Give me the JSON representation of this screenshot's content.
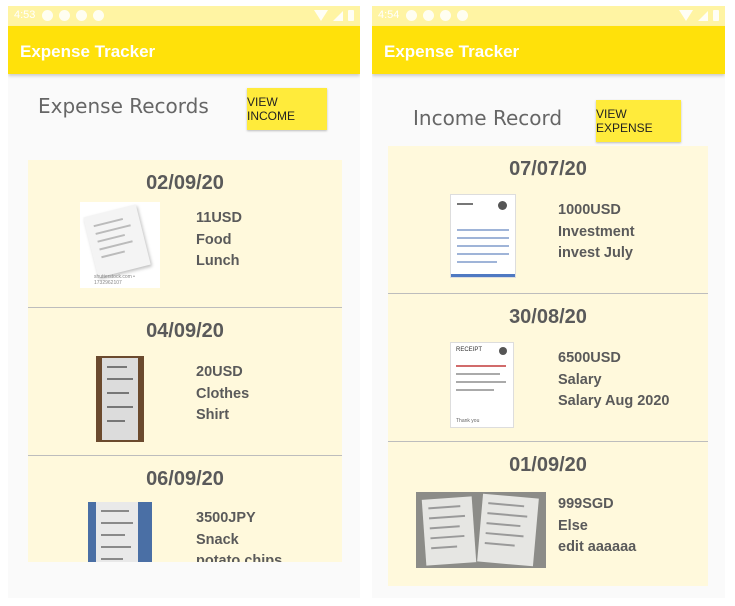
{
  "left": {
    "status_bar": {
      "time": "4:53"
    },
    "app_title": "Expense Tracker",
    "header_title": "Expense Records",
    "toggle_button": "VIEW INCOME",
    "records": [
      {
        "date": "02/09/20",
        "amount": "11USD",
        "category": "Food",
        "note": "Lunch",
        "thumb_caption": "shutterstock.com • 1732962107"
      },
      {
        "date": "04/09/20",
        "amount": "20USD",
        "category": "Clothes",
        "note": "Shirt"
      },
      {
        "date": "06/09/20",
        "amount": "3500JPY",
        "category": "Snack",
        "note": "potato chips"
      }
    ]
  },
  "right": {
    "status_bar": {
      "time": "4:54"
    },
    "app_title": "Expense Tracker",
    "header_title": "Income Record",
    "toggle_button": "VIEW EXPENSE",
    "records": [
      {
        "date": "07/07/20",
        "amount": "1000USD",
        "category": "Investment",
        "note": "invest July"
      },
      {
        "date": "30/08/20",
        "amount": "6500USD",
        "category": "Salary",
        "note": "Salary Aug 2020",
        "thumb_header": "RECEIPT",
        "thumb_footer": "Thank you"
      },
      {
        "date": "01/09/20",
        "amount": "999SGD",
        "category": "Else",
        "note": "edit aaaaaa"
      }
    ]
  },
  "colors": {
    "app_bar": "#ffe10a",
    "status_bar": "#fff4a3",
    "toggle_button": "#ffeb3b",
    "card_background": "#fff9dc",
    "text_secondary": "#5a5a5a"
  },
  "icons": [
    "settings-icon",
    "shield-icon",
    "sd-card-icon",
    "record-icon",
    "wifi-icon",
    "signal-icon",
    "battery-icon"
  ]
}
